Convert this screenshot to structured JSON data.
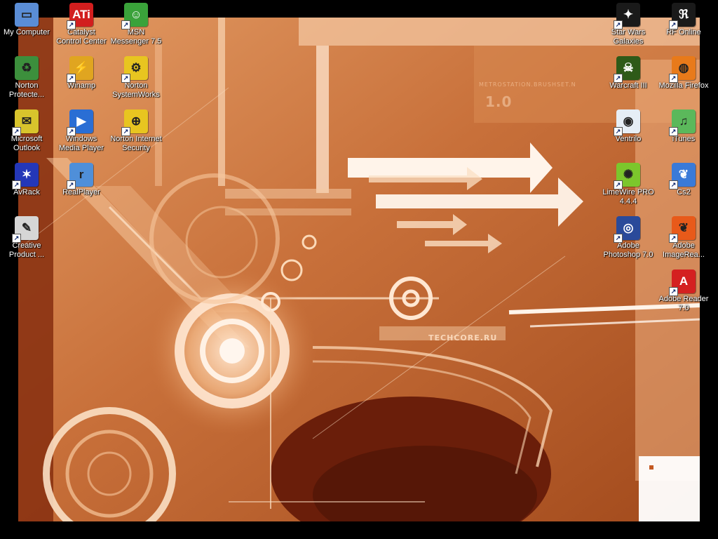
{
  "wallpaper": {
    "top_text": "METROSTATION.BRUSHSET.N",
    "version_text": "1.0",
    "brand_text": "TECHCORE.RU",
    "colors": {
      "base": "#c76a30",
      "light": "#f6c79c",
      "dark": "#6a1e0a",
      "frame": "#000000"
    }
  },
  "icons": [
    {
      "id": "my-computer",
      "label": "My Computer",
      "icon": "computer-icon",
      "shortcut": false,
      "color": "#5a8dd6",
      "glyph": "▭"
    },
    {
      "id": "norton-protected",
      "label": "Norton Protecte...",
      "icon": "recycle-bin-icon",
      "shortcut": false,
      "color": "#3c8f3c",
      "glyph": "♻"
    },
    {
      "id": "microsoft-outlook",
      "label": "Microsoft Outlook",
      "icon": "outlook-icon",
      "shortcut": true,
      "color": "#d8c42c",
      "glyph": "✉"
    },
    {
      "id": "avrack",
      "label": "AvRack",
      "icon": "avrack-icon",
      "shortcut": true,
      "color": "#2437b8",
      "glyph": "✶"
    },
    {
      "id": "creative-product",
      "label": "Creative Product ...",
      "icon": "creative-icon",
      "shortcut": true,
      "color": "#d6d6d6",
      "glyph": "✎"
    },
    {
      "id": "catalyst",
      "label": "Catalyst Control Center",
      "icon": "ati-icon",
      "shortcut": true,
      "color": "#d21e1e",
      "glyph": "ATi"
    },
    {
      "id": "winamp",
      "label": "Winamp",
      "icon": "winamp-icon",
      "shortcut": true,
      "color": "#e0a520",
      "glyph": "⚡"
    },
    {
      "id": "windows-media-player",
      "label": "Windows Media Player",
      "icon": "media-player-icon",
      "shortcut": true,
      "color": "#2a6ed4",
      "glyph": "▶"
    },
    {
      "id": "realplayer",
      "label": "RealPlayer",
      "icon": "realplayer-icon",
      "shortcut": true,
      "color": "#4f8fd9",
      "glyph": "r"
    },
    {
      "id": "msn",
      "label": "MSN Messenger 7.5",
      "icon": "msn-icon",
      "shortcut": true,
      "color": "#3aa23a",
      "glyph": "☺"
    },
    {
      "id": "norton-systemworks",
      "label": "Norton SystemWorks",
      "icon": "norton-systemworks-icon",
      "shortcut": true,
      "color": "#e8c520",
      "glyph": "⚙"
    },
    {
      "id": "norton-internet-security",
      "label": "Norton Internet Security",
      "icon": "norton-security-icon",
      "shortcut": true,
      "color": "#e8c520",
      "glyph": "⊕"
    },
    {
      "id": "star-wars-galaxies",
      "label": "Star Wars Galaxies",
      "icon": "star-wars-icon",
      "shortcut": true,
      "color": "#1a1a1a",
      "glyph": "✦"
    },
    {
      "id": "warcraft",
      "label": "Warcraft III",
      "icon": "warcraft-icon",
      "shortcut": true,
      "color": "#2e5a18",
      "glyph": "☠"
    },
    {
      "id": "ventrilo",
      "label": "Ventrilo",
      "icon": "ventrilo-icon",
      "shortcut": true,
      "color": "#e6eef6",
      "glyph": "◉"
    },
    {
      "id": "limewire",
      "label": "LimeWire PRO 4.4.4",
      "icon": "limewire-icon",
      "shortcut": true,
      "color": "#7cc62c",
      "glyph": "✺"
    },
    {
      "id": "adobe-photoshop",
      "label": "Adobe Photoshop 7.0",
      "icon": "photoshop-icon",
      "shortcut": true,
      "color": "#2a4a9a",
      "glyph": "◎"
    },
    {
      "id": "rf-online",
      "label": "RF Online",
      "icon": "rf-online-icon",
      "shortcut": true,
      "color": "#1a1a1a",
      "glyph": "ℜ"
    },
    {
      "id": "mozilla-firefox",
      "label": "Mozilla Firefox",
      "icon": "firefox-icon",
      "shortcut": true,
      "color": "#e87a1a",
      "glyph": "◍"
    },
    {
      "id": "itunes",
      "label": "iTunes",
      "icon": "itunes-icon",
      "shortcut": true,
      "color": "#5bb85b",
      "glyph": "♫"
    },
    {
      "id": "cs2",
      "label": "Cs2",
      "icon": "cs2-feather-icon",
      "shortcut": true,
      "color": "#3a7ad8",
      "glyph": "❦"
    },
    {
      "id": "adobe-imageready",
      "label": "Adobe ImageRea...",
      "icon": "imageready-icon",
      "shortcut": true,
      "color": "#e85a1a",
      "glyph": "❦"
    },
    {
      "id": "adobe-reader",
      "label": "Adobe Reader 7.0",
      "icon": "adobe-reader-icon",
      "shortcut": true,
      "color": "#d42020",
      "glyph": "A"
    }
  ]
}
